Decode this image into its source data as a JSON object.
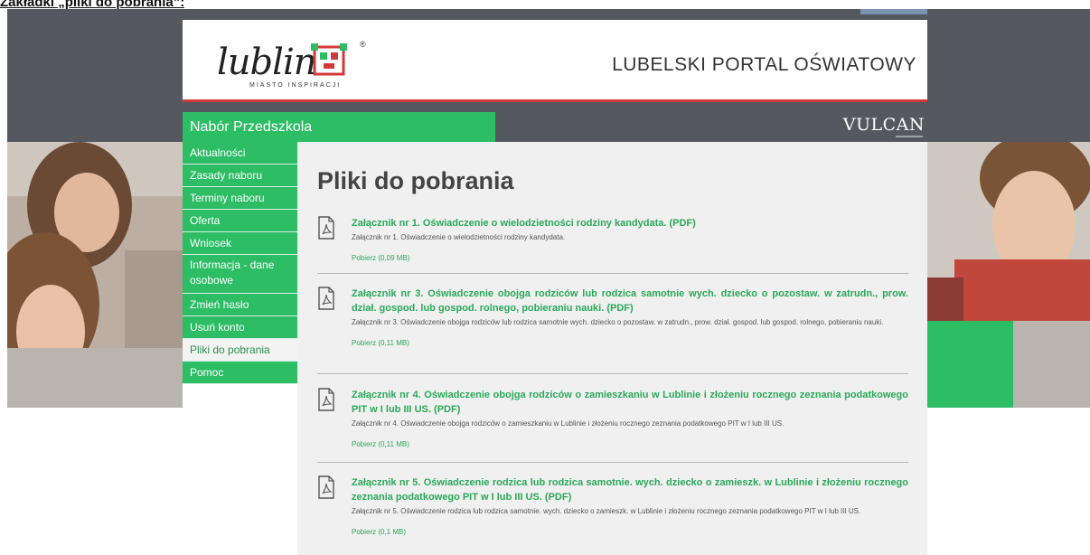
{
  "caption": "Zakładki „pliki do pobrania”:",
  "header": {
    "logo_word": "lublin",
    "logo_sub": "MIASTO INSPIRACJI",
    "logo_reg": "®",
    "portal_title": "LUBELSKI PORTAL OŚWIATOWY"
  },
  "nabor_label": "Nabór Przedszkola",
  "vulcan": "VULCAN",
  "sidebar": {
    "items": [
      {
        "label": "Aktualności"
      },
      {
        "label": "Zasady naboru"
      },
      {
        "label": "Terminy naboru"
      },
      {
        "label": "Oferta"
      },
      {
        "label": "Wniosek"
      },
      {
        "label": "Informacja - dane osobowe"
      },
      {
        "label": "Zmień hasło"
      },
      {
        "label": "Usuń konto"
      },
      {
        "label": "Pliki do pobrania"
      },
      {
        "label": "Pomoc"
      }
    ],
    "active": "Pliki do pobrania"
  },
  "main": {
    "title": "Pliki do pobrania",
    "files": [
      {
        "title": "Załącznik nr 1. Oświadczenie o wielodzietności rodziny kandydata. (PDF)",
        "desc": "Załącznik nr 1. Oświadczenie o wielodzietności rodziny kandydata.",
        "link": "Pobierz (0,09 MB)"
      },
      {
        "title": "Załącznik nr 3. Oświadczenie obojga rodziców lub rodzica samotnie wych. dziecko o pozostaw. w zatrudn., prow. dział. gospod. lub gospod. rolnego, pobieraniu nauki. (PDF)",
        "desc": "Załącznik nr 3. Oświadczenie obojga rodziców lub rodzica samotnie wych. dziecko o pozostaw. w zatrudn., prow. dział. gospod. lub gospod. rolnego, pobieraniu nauki.",
        "link": "Pobierz (0,11 MB)"
      },
      {
        "title": "Załącznik nr 4. Oświadczenie obojga rodziców o zamieszkaniu w Lublinie i złożeniu rocznego zeznania podatkowego PIT w I lub III US. (PDF)",
        "desc": "Załącznik nr 4. Oświadczenie obojga rodziców o zamieszkaniu w Lublinie i złożeniu rocznego zeznania podatkowego PIT w I lub III US.",
        "link": "Pobierz (0,11 MB)"
      },
      {
        "title": "Załącznik nr 5. Oświadczenie rodzica lub rodzica samotnie. wych. dziecko o zamieszk. w Lublinie i złożeniu rocznego zeznania podatkowego PIT w I lub III US. (PDF)",
        "desc": "Załącznik nr 5. Oświadczenie rodzica lub rodzica samotnie. wych. dziecko o zamieszk. w Lublinie i złożeniu rocznego zeznania podatkowego PIT w I lub III US.",
        "link": "Pobierz (0,1 MB)"
      }
    ]
  },
  "colors": {
    "accent": "#2dbd65",
    "header_band": "#55585f",
    "red_line": "#d23a3a",
    "link": "#2aa85a"
  },
  "icons": {
    "file_icon": "pdf-file-icon",
    "logo_mark": "lublin-logo-mark"
  }
}
